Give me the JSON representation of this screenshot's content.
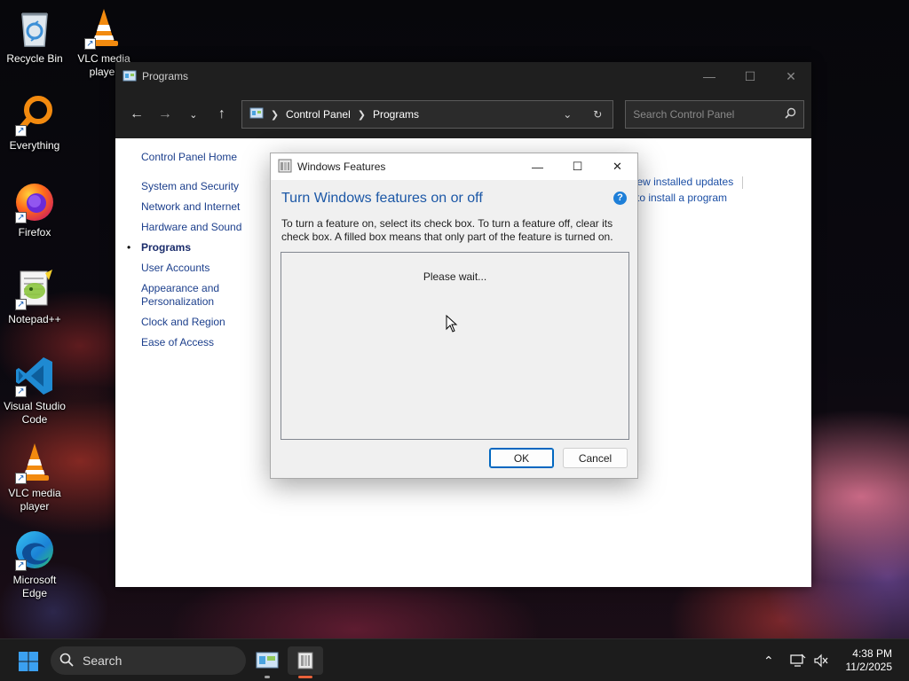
{
  "desktop": {
    "icons": [
      {
        "label": "Recycle Bin"
      },
      {
        "label": "VLC media player"
      },
      {
        "label": "Everything"
      },
      {
        "label": "Firefox"
      },
      {
        "label": "Notepad++"
      },
      {
        "label": "Visual Studio Code"
      },
      {
        "label": "VLC media player"
      },
      {
        "label": "Microsoft Edge"
      }
    ]
  },
  "control_panel": {
    "window_title": "Programs",
    "breadcrumb": [
      "Control Panel",
      "Programs"
    ],
    "search_placeholder": "Search Control Panel",
    "nav": {
      "home": "Control Panel Home",
      "items": [
        "System and Security",
        "Network and Internet",
        "Hardware and Sound",
        "Programs",
        "User Accounts",
        "Appearance and Personalization",
        "Clock and Region",
        "Ease of Access"
      ],
      "current": "Programs"
    },
    "links": {
      "view_updates": "View installed updates",
      "how_to_install": "w to install a program"
    }
  },
  "features_dialog": {
    "title": "Windows Features",
    "heading": "Turn Windows features on or off",
    "description": "To turn a feature on, select its check box. To turn a feature off, clear its check box. A filled box means that only part of the feature is turned on.",
    "status": "Please wait...",
    "ok_label": "OK",
    "cancel_label": "Cancel"
  },
  "taskbar": {
    "search_label": "Search",
    "time": "4:38 PM",
    "date": "11/2/2025"
  },
  "colors": {
    "accent": "#0067c0",
    "link": "#1c3f8c",
    "heading": "#1b57a6"
  }
}
